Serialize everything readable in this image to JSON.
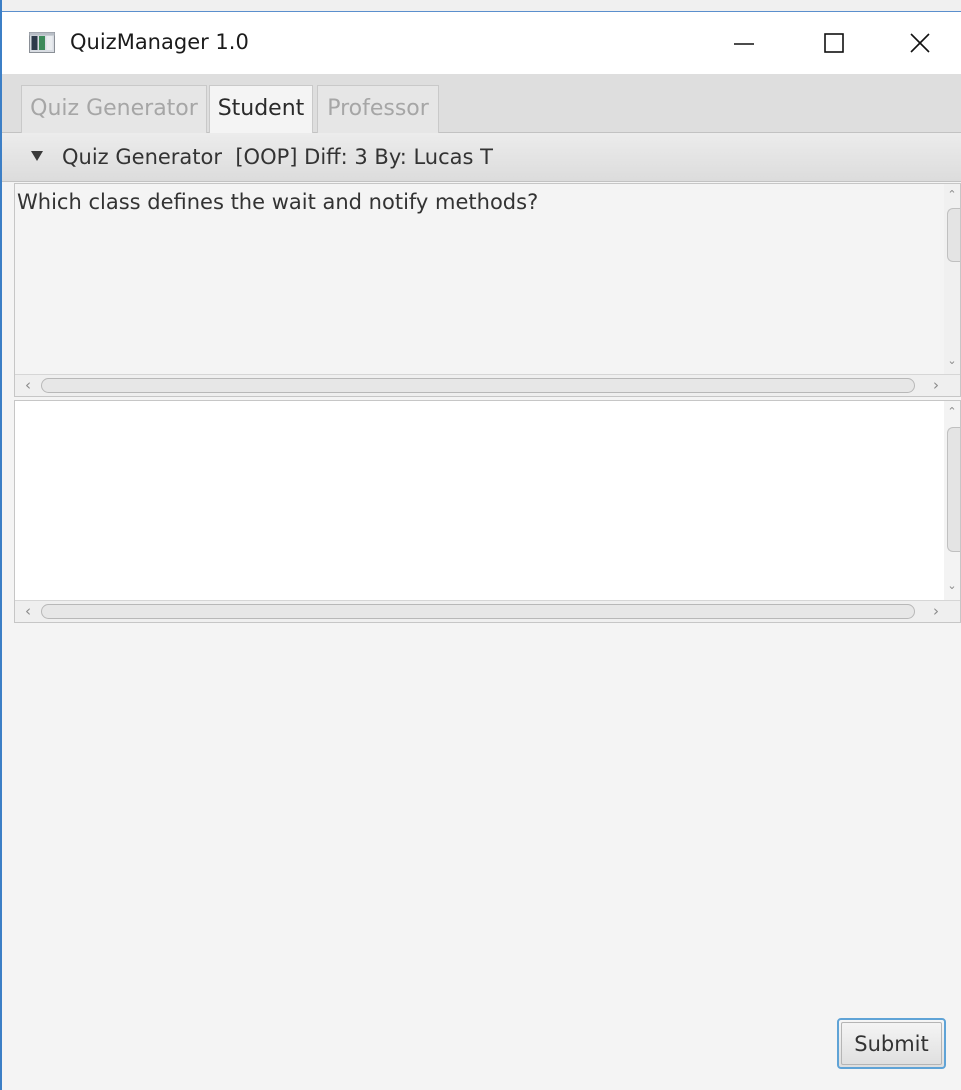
{
  "window": {
    "title": "QuizManager 1.0",
    "icon": "app-window-icon",
    "controls": [
      "minimize-icon",
      "maximize-icon",
      "close-icon"
    ]
  },
  "tabs": [
    {
      "label": "Quiz Generator",
      "state": "disabled"
    },
    {
      "label": "Student",
      "state": "selected"
    },
    {
      "label": "Professor",
      "state": "disabled"
    }
  ],
  "pane": {
    "title": "Quiz Generator  [OOP] Diff: 3 By: Lucas T",
    "expanded": true
  },
  "question": {
    "text": "Which class defines the wait and notify methods?"
  },
  "answer": {
    "value": ""
  },
  "submit_label": "Submit",
  "colors": {
    "window_border": "#3c7fc6",
    "background": "#f4f4f4",
    "submit_focus_ring": "#5fa3d6"
  }
}
